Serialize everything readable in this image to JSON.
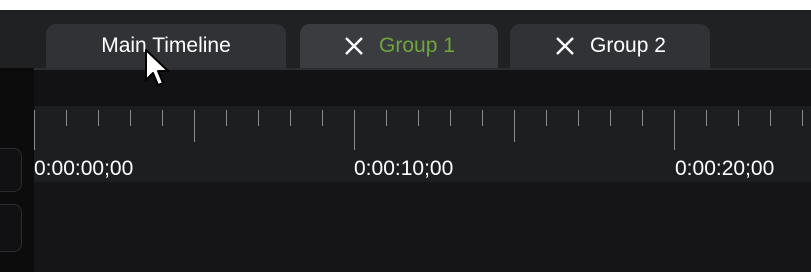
{
  "tabs": [
    {
      "label": "Main Timeline",
      "active": false,
      "closable": false
    },
    {
      "label": "Group 1",
      "active": true,
      "closable": true
    },
    {
      "label": "Group 2",
      "active": false,
      "closable": true
    }
  ],
  "ruler": {
    "time_labels": [
      "0:00:00;00",
      "0:00:10;00",
      "0:00:20;00"
    ]
  },
  "colors": {
    "active_tab_text": "#6fa53c",
    "tab_text": "#ffffff",
    "background": "#000000"
  },
  "icons": {
    "close": "close-x-icon",
    "cursor": "mouse-pointer-icon"
  }
}
